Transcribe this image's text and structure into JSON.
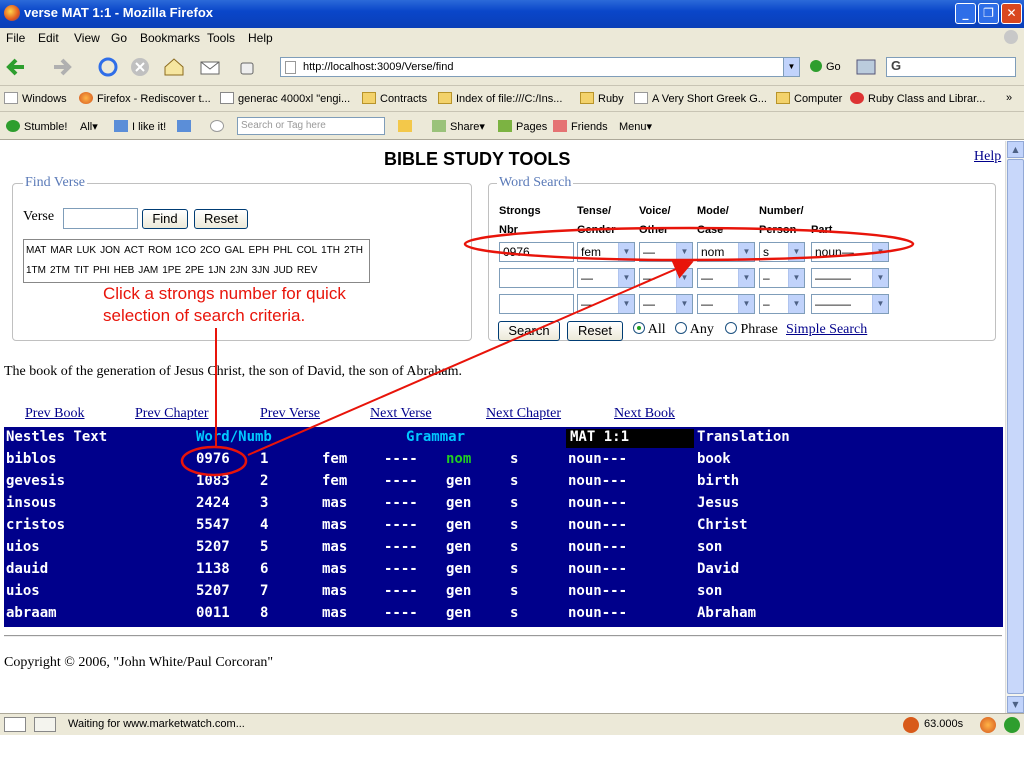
{
  "window": {
    "title": "verse MAT 1:1 - Mozilla Firefox",
    "buttons": [
      "_",
      "❐",
      "✕"
    ]
  },
  "menu": [
    "File",
    "Edit",
    "View",
    "Go",
    "Bookmarks",
    "Tools",
    "Help"
  ],
  "navbar": {
    "url": "http://localhost:3009/Verse/find",
    "go_label": "Go",
    "search_value": "G"
  },
  "bookmarks": [
    "Windows",
    "Firefox - Rediscover t...",
    "generac 4000xl \"engi...",
    "Contracts",
    "Index of file:///C:/Ins...",
    "Ruby",
    "A Very Short Greek G...",
    "Computer",
    "Ruby Class and Librar..."
  ],
  "bookmarks_more": "»",
  "stumble": {
    "stumble": "Stumble!",
    "all": "All",
    "ilike": "I like it!",
    "search_placeholder": "Search or Tag here",
    "share": "Share",
    "pages": "Pages",
    "friends": "Friends",
    "menu": "Menu"
  },
  "page": {
    "heading": "BIBLE STUDY TOOLS",
    "help": "Help",
    "find_verse": {
      "legend": "Find Verse",
      "label": "Verse",
      "value": "",
      "find": "Find",
      "reset": "Reset",
      "books_row1": [
        "MAT",
        "MAR",
        "LUK",
        "JON",
        "ACT",
        "ROM",
        "1CO",
        "2CO",
        "GAL",
        "EPH",
        "PHL",
        "COL",
        "1TH",
        "2TH"
      ],
      "books_row2": [
        "1TM",
        "2TM",
        "TIT",
        "PHI",
        "HEB",
        "JAM",
        "1PE",
        "2PE",
        "1JN",
        "2JN",
        "3JN",
        "JUD",
        "REV"
      ]
    },
    "word_search": {
      "legend": "Word Search",
      "headers": {
        "strongs": "Strongs",
        "strongs2": "Nbr",
        "tense": "Tense/",
        "tense2": "Gender",
        "voice": "Voice/",
        "voice2": "Other",
        "mode": "Mode/",
        "mode2": "Case",
        "number": "Number/",
        "number2": "Person",
        "part": "Part"
      },
      "row1": {
        "strongs": "0976",
        "tense": "fem",
        "voice": "—",
        "mode": "nom",
        "number": "s",
        "part": "noun—"
      },
      "empty_dash": "—",
      "empty_dash_long": "———",
      "empty_s": "–",
      "search": "Search",
      "reset": "Reset",
      "all": "All",
      "any": "Any",
      "phrase": "Phrase",
      "simple": "Simple Search"
    },
    "annotation": [
      "Click a strongs number for quick",
      "selection of search criteria."
    ],
    "verse_text": "The book of the generation of Jesus Christ, the son of David, the son of Abraham.",
    "nav": {
      "prev_book": "Prev Book",
      "prev_chapter": "Prev Chapter",
      "prev_verse": "Prev Verse",
      "next_verse": "Next Verse",
      "next_chapter": "Next Chapter",
      "next_book": "Next Book"
    },
    "grid": {
      "headers": {
        "text": "Nestles Text",
        "word": "Word/Numb",
        "grammar": "Grammar",
        "ref": "MAT 1:1",
        "translation": "Translation"
      },
      "rows": [
        {
          "greek": "biblos",
          "strongs": "0976",
          "num": "1",
          "g": "fem",
          "v": "----",
          "c": "nom",
          "n": "s",
          "p": "noun---",
          "t": "book"
        },
        {
          "greek": "gevesis",
          "strongs": "1083",
          "num": "2",
          "g": "fem",
          "v": "----",
          "c": "gen",
          "n": "s",
          "p": "noun---",
          "t": "birth"
        },
        {
          "greek": "insous",
          "strongs": "2424",
          "num": "3",
          "g": "mas",
          "v": "----",
          "c": "gen",
          "n": "s",
          "p": "noun---",
          "t": "Jesus"
        },
        {
          "greek": "cristos",
          "strongs": "5547",
          "num": "4",
          "g": "mas",
          "v": "----",
          "c": "gen",
          "n": "s",
          "p": "noun---",
          "t": "Christ"
        },
        {
          "greek": "uios",
          "strongs": "5207",
          "num": "5",
          "g": "mas",
          "v": "----",
          "c": "gen",
          "n": "s",
          "p": "noun---",
          "t": "son"
        },
        {
          "greek": "dauid",
          "strongs": "1138",
          "num": "6",
          "g": "mas",
          "v": "----",
          "c": "gen",
          "n": "s",
          "p": "noun---",
          "t": "David"
        },
        {
          "greek": "uios",
          "strongs": "5207",
          "num": "7",
          "g": "mas",
          "v": "----",
          "c": "gen",
          "n": "s",
          "p": "noun---",
          "t": "son"
        },
        {
          "greek": "abraam",
          "strongs": "0011",
          "num": "8",
          "g": "mas",
          "v": "----",
          "c": "gen",
          "n": "s",
          "p": "noun---",
          "t": "Abraham"
        }
      ]
    },
    "copyright": "Copyright © 2006, \"John White/Paul Corcoran\""
  },
  "status": {
    "text": "Waiting for www.marketwatch.com...",
    "timer": "63.000s"
  },
  "colors": {
    "grid_bg": "#00008b",
    "annotation": "#e8140a",
    "link": "#00008b"
  }
}
